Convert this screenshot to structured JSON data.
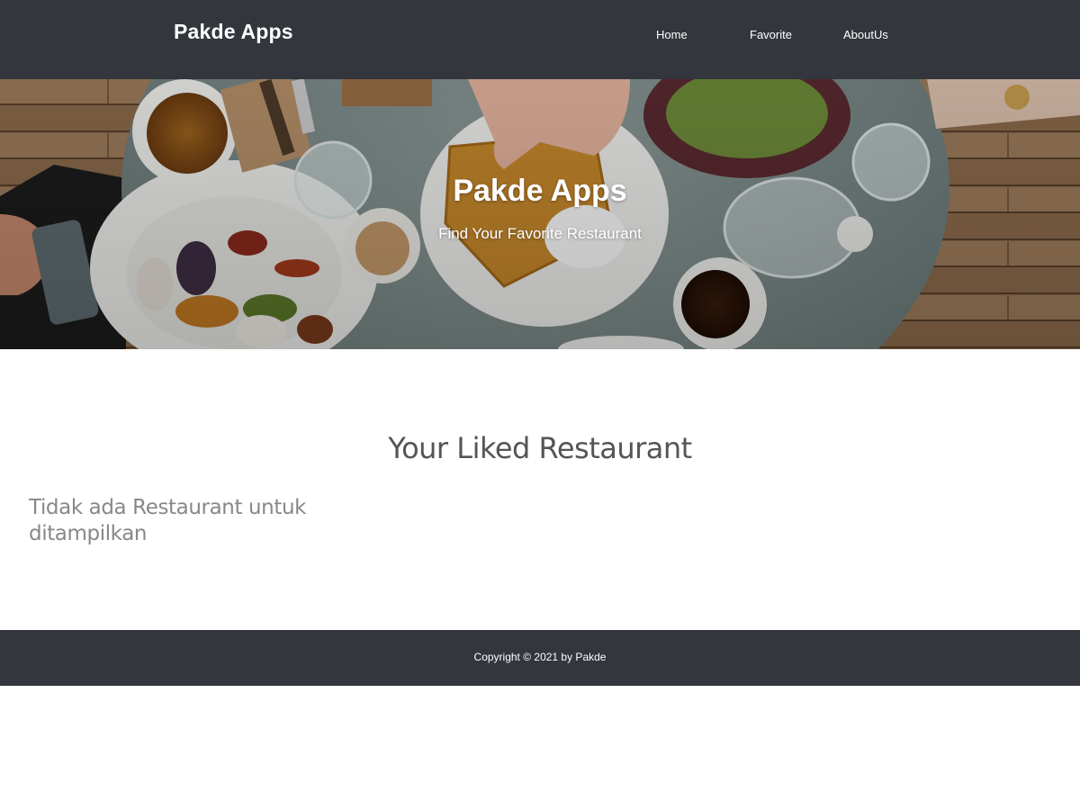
{
  "header": {
    "brand": "Pakde Apps",
    "nav": [
      {
        "label": "Home"
      },
      {
        "label": "Favorite"
      },
      {
        "label": "AboutUs"
      }
    ]
  },
  "hero": {
    "title": "Pakde Apps",
    "tagline": "Find Your Favorite Restaurant",
    "image": "restaurant-table-photo"
  },
  "main": {
    "section_title": "Your Liked Restaurant",
    "empty_message": "Tidak ada Restaurant untuk ditampilkan"
  },
  "footer": {
    "copyright": "Copyright © 2021 by Pakde"
  },
  "colors": {
    "header_bg": "#33363d",
    "footer_bg": "#33363d",
    "text_heading": "#555555",
    "text_muted": "#888888"
  }
}
